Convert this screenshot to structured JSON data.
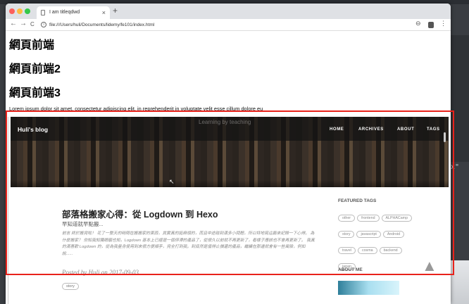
{
  "browser": {
    "tab_title": "I am titleqdwd",
    "new_tab": "+",
    "tab_close": "×",
    "url": "file:///Users/huli/Documents/lidemy/fe101/index.html",
    "nav": {
      "back": "←",
      "forward": "→",
      "reload": "C"
    }
  },
  "page": {
    "headings": [
      "網頁前端",
      "網頁前端2",
      "網頁前端3"
    ],
    "lorem": "Lorem ipsum dolor sit amet, consectetur adipiscing elit, in reprehenderit in voluptate velit esse cillum dolore eu"
  },
  "blog": {
    "brand": "Huli's blog",
    "hero_text": "Learning by teaching",
    "menu": [
      "HOME",
      "ARCHIVES",
      "ABOUT",
      "TAGS"
    ],
    "post": {
      "title": "部落格搬家心得：從 Logdown 到 Hexo",
      "subtitle": "早知道就早點搬...",
      "excerpt": "前言 終於搬完啦！ 花了一整天的時間在搬搬家的東西，其實真的挺麻煩的，而且中途碰到滿多小問題，所以特地寫這篇來紀錄一下心得。 為什麼搬家？ 你知我知獨眼龍也知，Logdown 基本上已經是一個停滯的產品了，從很久以前就不再更新了，看樣子應該也不會再更新了。 我真的滿喜歡 Logdown 的，從為我量身使用到來很方便順手，完全打到我。到底然是值得止損還的產品，繼續在那邊就會有一些風險，例如說......",
      "meta": "Posted by Huli on 2017-09-03",
      "tag": "story"
    },
    "featured_title": "FEATURED TAGS",
    "tags": [
      "other",
      "frontend",
      "ALPHACamp",
      "story",
      "javascript",
      "Android",
      "travel",
      "cosma",
      "backend",
      "japan"
    ],
    "about_title": "ABOUT ME"
  },
  "desktop": {
    "code_fragment": "0x\""
  },
  "colors": {
    "highlight": "#e8221b"
  }
}
